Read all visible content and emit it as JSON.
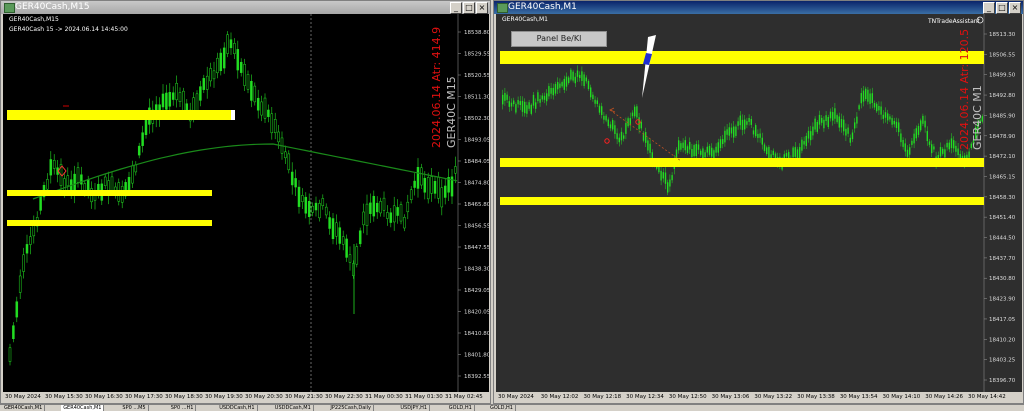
{
  "left_window": {
    "title": "GER40Cash,M15",
    "chart_symbol": "GER40Cash,M15",
    "info_line": "GER40Cash 15 -> 2024.06.14 14:45:00",
    "watermark_symbol": "GER40C M15",
    "watermark_atr": "2024.06.14 Atr: 414.9",
    "price_labels": [
      "18538.80",
      "18529.55",
      "18520.55",
      "18511.30",
      "18502.30",
      "18493.05",
      "18484.05",
      "18474.80",
      "18465.80",
      "18456.55",
      "18447.55",
      "18438.30",
      "18429.05",
      "18420.05",
      "18410.80",
      "18401.80",
      "18392.55"
    ],
    "time_labels": [
      "30 May 2024",
      "30 May 15:30",
      "30 May 16:30",
      "30 May 17:30",
      "30 May 18:30",
      "30 May 19:30",
      "30 May 20:30",
      "30 May 21:30",
      "30 May 22:30",
      "31 May 00:30",
      "31 May 01:30",
      "31 May 02:45"
    ]
  },
  "right_window": {
    "title": "GER40Cash,M1",
    "chart_symbol": "GER40Cash,M1",
    "panel_button": "Panel Be/Kl",
    "ea_label": "TNTradeAssistant",
    "watermark_symbol": "GER40C M1",
    "watermark_atr": "2024.06.14 Atr: 120.5",
    "price_labels": [
      "18513.30",
      "18506.55",
      "18499.50",
      "18492.80",
      "18485.90",
      "18478.90",
      "18472.10",
      "18465.15",
      "18458.30",
      "18451.40",
      "18444.50",
      "18437.70",
      "18430.80",
      "18423.90",
      "18417.05",
      "18410.20",
      "18403.25",
      "18396.70"
    ],
    "time_labels": [
      "30 May 2024",
      "30 May 12:02",
      "30 May 12:18",
      "30 May 12:34",
      "30 May 12:50",
      "30 May 13:06",
      "30 May 13:22",
      "30 May 13:38",
      "30 May 13:54",
      "30 May 14:10",
      "30 May 14:26",
      "30 May 14:42"
    ]
  },
  "tabs": [
    "GER40Cash,M1",
    "GER40Cash,M1",
    "SP0 ...M5",
    "SP0 ...H1",
    "USDDCash,H1",
    "USDDCash,M1",
    "JP225Cash,Daily",
    "USDJPY,H1",
    "GOLD,H1",
    "GOLD,H1"
  ],
  "colors": {
    "bull": "#22dd22",
    "bear": "#22dd22",
    "zone": "#ffff00",
    "watermark_red": "#e01010",
    "watermark_grey": "#c0c0c0",
    "ma": "#1a8a1a"
  }
}
